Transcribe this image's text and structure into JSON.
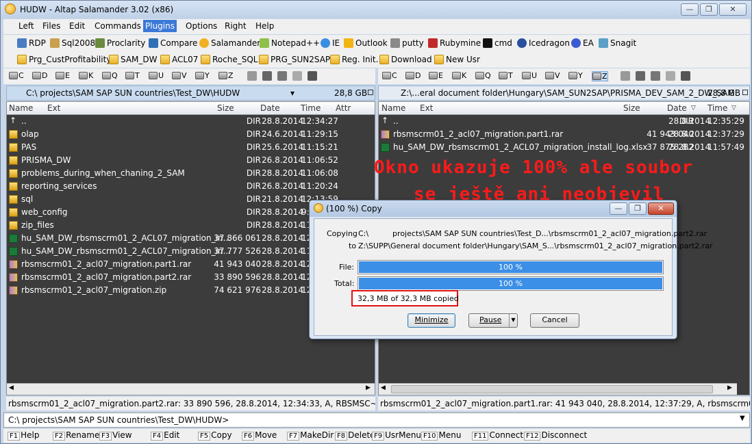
{
  "window": {
    "title": "HUDW - Altap Salamander 3.02 (x86)"
  },
  "menu": [
    "Left",
    "Files",
    "Edit",
    "Commands",
    "Plugins",
    "Options",
    "Right",
    "Help"
  ],
  "menu_selected": "Plugins",
  "toolbar1": [
    "RDP",
    "Sql2008",
    "Proclarity",
    "Compare",
    "Salamander",
    "Notepad++",
    "IE",
    "Outlook",
    "putty",
    "Rubymine",
    "cmd",
    "Icedragon",
    "EA",
    "Snagit"
  ],
  "toolbar2": [
    "Prg_CustProfitability",
    "SAM_DW",
    "ACL07",
    "Roche_SQL",
    "PRG_SUN2SAP",
    "Reg. Init.",
    "Download",
    "New Usr"
  ],
  "drives": [
    "C",
    "D",
    "E",
    "K",
    "Q",
    "T",
    "U",
    "V",
    "Y",
    "Z"
  ],
  "left": {
    "path": "C:\\          projects\\SAM SAP SUN countries\\Test_DW\\HUDW",
    "free": "28,8 GB",
    "headers": {
      "name": "Name",
      "ext": "Ext",
      "size": "Size",
      "date": "Date",
      "time": "Time",
      "attr": "Attr"
    },
    "rows": [
      {
        "icon": "up",
        "name": "..",
        "size": "DIR",
        "date": "28.8.2014",
        "time": "12:34:27"
      },
      {
        "icon": "folder",
        "name": "olap",
        "size": "DIR",
        "date": "24.6.2014",
        "time": "11:29:15"
      },
      {
        "icon": "folder",
        "name": "PAS",
        "size": "DIR",
        "date": "25.6.2014",
        "time": "11:15:21"
      },
      {
        "icon": "folder",
        "name": "PRISMA_DW",
        "size": "DIR",
        "date": "26.8.2014",
        "time": "11:06:52"
      },
      {
        "icon": "folder",
        "name": "problems_during_when_chaning_2_SAM",
        "size": "DIR",
        "date": "28.8.2014",
        "time": "11:06:08"
      },
      {
        "icon": "folder",
        "name": "reporting_services",
        "size": "DIR",
        "date": "26.8.2014",
        "time": "11:20:24"
      },
      {
        "icon": "folder",
        "name": "sql",
        "size": "DIR",
        "date": "21.8.2014",
        "time": "12:13:59"
      },
      {
        "icon": "folder",
        "name": "web_config",
        "size": "DIR",
        "date": "28.8.2014",
        "time": "9:..."
      },
      {
        "icon": "folder",
        "name": "zip_files",
        "size": "DIR",
        "date": "28.8.2014",
        "time": "11:..."
      },
      {
        "icon": "xl",
        "name": "hu_SAM_DW_rbsmscrm01_2_ACL07_migration_in...",
        "size": "37 866 061",
        "date": "28.8.2014",
        "time": "12:..."
      },
      {
        "icon": "xl",
        "name": "hu_SAM_DW_rbsmscrm01_2_ACL07_migration_in...",
        "size": "37 777 526",
        "date": "28.8.2014",
        "time": "11:..."
      },
      {
        "icon": "rar",
        "name": "rbsmscrm01_2_acl07_migration.part1.rar",
        "size": "41 943 040",
        "date": "28.8.2014",
        "time": "12:..."
      },
      {
        "icon": "rar",
        "name": "rbsmscrm01_2_acl07_migration.part2.rar",
        "size": "33 890 596",
        "date": "28.8.2014",
        "time": "12:..."
      },
      {
        "icon": "rar",
        "name": "rbsmscrm01_2_acl07_migration.zip",
        "size": "74 621 976",
        "date": "28.8.2014",
        "time": "12:..."
      }
    ],
    "status": "rbsmscrm01_2_acl07_migration.part2.rar: 33 890 596, 28.8.2014, 12:34:33, A, RBSMSC~2.RAR"
  },
  "right": {
    "path": "Z:\\...eral document folder\\Hungary\\SAM_SUN2SAP\\PRISMA_DEV_SAM_2_DW_SAM",
    "free": "28,8 GB",
    "headers": {
      "name": "Name",
      "ext": "Ext",
      "size": "Size",
      "date": "Date",
      "time": "Time"
    },
    "rows": [
      {
        "icon": "up",
        "name": "..",
        "size": "DIR",
        "date": "28.8.2014",
        "time": "12:35:29"
      },
      {
        "icon": "rar",
        "name": "rbsmscrm01_2_acl07_migration.part1.rar",
        "size": "41 943 040",
        "date": "28.8.2014",
        "time": "12:37:29"
      },
      {
        "icon": "xl",
        "name": "hu_SAM_DW_rbsmscrm01_2_ACL07_migration_install_log.xlsx",
        "size": "37 875 282",
        "date": "28.8.2014",
        "time": "11:57:49"
      }
    ],
    "status": "rbsmscrm01_2_acl07_migration.part1.rar: 41 943 040, 28.8.2014, 12:37:29, A, rbsmscrm01_2_acl07_mi..."
  },
  "annotation": {
    "line1": "Okno ukazuje 100% ale soubor",
    "line2": "se ještě ani neobjevil"
  },
  "dialog": {
    "title": "(100 %) Copy",
    "copying_label": "Copying",
    "copying_value": "C:\\          projects\\SAM SAP SUN countries\\Test_D...\\rbsmscrm01_2_acl07_migration.part2.rar",
    "to_label": "to",
    "to_value": "Z:\\SUPP\\General document folder\\Hungary\\SAM_S...\\rbsmscrm01_2_acl07_migration.part2.rar",
    "file_label": "File:",
    "file_progress": 100,
    "file_text": "100 %",
    "total_label": "Total:",
    "total_progress": 100,
    "total_text": "100 %",
    "copied_text": "32,3 MB of 32,3 MB copied",
    "minimize": "Minimize",
    "pause": "Pause",
    "cancel": "Cancel"
  },
  "cmdline": "C:\\          projects\\SAM SAP SUN countries\\Test_DW\\HUDW>",
  "fkeys": [
    {
      "k": "F1",
      "l": "Help"
    },
    {
      "k": "F2",
      "l": "Rename"
    },
    {
      "k": "F3",
      "l": "View"
    },
    {
      "k": "F4",
      "l": "Edit"
    },
    {
      "k": "F5",
      "l": "Copy"
    },
    {
      "k": "F6",
      "l": "Move"
    },
    {
      "k": "F7",
      "l": "MakeDir"
    },
    {
      "k": "F8",
      "l": "Delete"
    },
    {
      "k": "F9",
      "l": "UsrMenu"
    },
    {
      "k": "F10",
      "l": "Menu"
    },
    {
      "k": "F11",
      "l": "Connect"
    },
    {
      "k": "F12",
      "l": "Disconnect"
    }
  ]
}
